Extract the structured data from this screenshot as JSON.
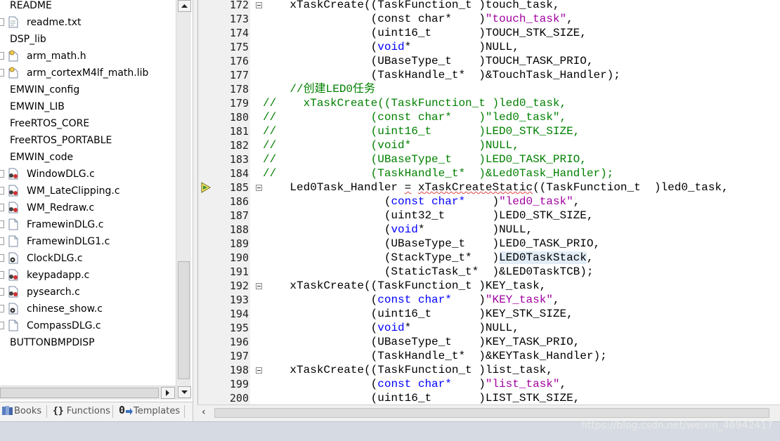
{
  "project_tree": {
    "items": [
      {
        "label": "README",
        "level": 0,
        "icon": "folder-icon"
      },
      {
        "label": "readme.txt",
        "level": 1,
        "icon": "text-file-icon"
      },
      {
        "label": "DSP_lib",
        "level": 0,
        "icon": "folder-icon"
      },
      {
        "label": "arm_math.h",
        "level": 1,
        "icon": "header-file-icon"
      },
      {
        "label": "arm_cortexM4lf_math.lib",
        "level": 1,
        "icon": "library-file-icon"
      },
      {
        "label": "EMWIN_config",
        "level": 0,
        "icon": "folder-icon"
      },
      {
        "label": "EMWIN_LIB",
        "level": 0,
        "icon": "folder-icon"
      },
      {
        "label": "FreeRTOS_CORE",
        "level": 0,
        "icon": "folder-icon"
      },
      {
        "label": "FreeRTOS_PORTABLE",
        "level": 0,
        "icon": "folder-icon"
      },
      {
        "label": "EMWIN_code",
        "level": 0,
        "icon": "folder-icon"
      },
      {
        "label": "WindowDLG.c",
        "level": 1,
        "icon": "c-file-error-icon"
      },
      {
        "label": "WM_LateClipping.c",
        "level": 1,
        "icon": "c-file-error-icon"
      },
      {
        "label": "WM_Redraw.c",
        "level": 1,
        "icon": "c-file-error-icon"
      },
      {
        "label": "FramewinDLG.c",
        "level": 1,
        "icon": "c-file-icon"
      },
      {
        "label": "FramewinDLG1.c",
        "level": 1,
        "icon": "c-file-icon"
      },
      {
        "label": "ClockDLG.c",
        "level": 1,
        "icon": "c-file-gear-icon"
      },
      {
        "label": "keypadapp.c",
        "level": 1,
        "icon": "c-file-error-icon"
      },
      {
        "label": "pysearch.c",
        "level": 1,
        "icon": "c-file-error-icon"
      },
      {
        "label": "chinese_show.c",
        "level": 1,
        "icon": "c-file-gear-icon"
      },
      {
        "label": "CompassDLG.c",
        "level": 1,
        "icon": "c-file-icon"
      },
      {
        "label": "BUTTONBMPDISP",
        "level": 0,
        "icon": "folder-icon"
      }
    ]
  },
  "tabs": [
    {
      "label": "Books",
      "icon": "books-icon"
    },
    {
      "label": "Functions",
      "icon": "braces-icon"
    },
    {
      "label": "Templates",
      "icon": "templates-icon"
    }
  ],
  "editor": {
    "current_line": 185,
    "lines": [
      {
        "n": "172",
        "fold": "open",
        "parts": [
          [
            "",
            "    xTaskCreate((TaskFunction_t )touch_task,"
          ]
        ]
      },
      {
        "n": "173",
        "parts": [
          [
            "",
            "                (const char*    )"
          ],
          [
            "str",
            "\"touch_task\""
          ],
          [
            "",
            ","
          ]
        ]
      },
      {
        "n": "174",
        "parts": [
          [
            "",
            "                (uint16_t       )TOUCH_STK_SIZE,"
          ]
        ]
      },
      {
        "n": "175",
        "parts": [
          [
            "",
            "                ("
          ],
          [
            "kw",
            "void"
          ],
          [
            "",
            "*          )NULL,"
          ]
        ]
      },
      {
        "n": "176",
        "parts": [
          [
            "",
            "                (UBaseType_t    )TOUCH_TASK_PRIO,"
          ]
        ]
      },
      {
        "n": "177",
        "parts": [
          [
            "",
            "                (TaskHandle_t*  )&TouchTask_Handler);"
          ]
        ]
      },
      {
        "n": "178",
        "parts": [
          [
            "cmt",
            "    //创建LED0任务"
          ]
        ]
      },
      {
        "n": "179",
        "parts": [
          [
            "cmt",
            "//    xTaskCreate((TaskFunction_t )led0_task,"
          ]
        ]
      },
      {
        "n": "180",
        "parts": [
          [
            "cmt",
            "//              (const char*    )\"led0_task\","
          ]
        ]
      },
      {
        "n": "181",
        "parts": [
          [
            "cmt",
            "//              (uint16_t       )LED0_STK_SIZE,"
          ]
        ]
      },
      {
        "n": "182",
        "parts": [
          [
            "cmt",
            "//              (void*          )NULL,"
          ]
        ]
      },
      {
        "n": "183",
        "parts": [
          [
            "cmt",
            "//              (UBaseType_t    )LED0_TASK_PRIO,"
          ]
        ]
      },
      {
        "n": "184",
        "parts": [
          [
            "cmt",
            "//              (TaskHandle_t*  )&Led0Task_Handler);"
          ]
        ]
      },
      {
        "n": "185",
        "fold": "open",
        "parts": [
          [
            "",
            "    Led0Task_Handler "
          ],
          [
            "squig",
            "="
          ],
          [
            "",
            " "
          ],
          [
            "squig",
            "xTaskCreateStatic"
          ],
          [
            "",
            "((TaskFunction_t  )led0_task,"
          ]
        ]
      },
      {
        "n": "186",
        "parts": [
          [
            "",
            "                  ("
          ],
          [
            "kw",
            "const char*"
          ],
          [
            "",
            "    )"
          ],
          [
            "str",
            "\"led0_task\""
          ],
          [
            "",
            ","
          ]
        ]
      },
      {
        "n": "187",
        "parts": [
          [
            "",
            "                  (uint32_t       )LED0_STK_SIZE,"
          ]
        ]
      },
      {
        "n": "188",
        "parts": [
          [
            "",
            "                  ("
          ],
          [
            "kw",
            "void"
          ],
          [
            "",
            "*          )NULL,"
          ]
        ]
      },
      {
        "n": "189",
        "parts": [
          [
            "",
            "                  (UBaseType_t    )LED0_TASK_PRIO,"
          ]
        ]
      },
      {
        "n": "190",
        "parts": [
          [
            "",
            "                  (StackType_t*   )"
          ],
          [
            "sel",
            "LED0TaskStack"
          ],
          [
            "",
            ","
          ]
        ]
      },
      {
        "n": "191",
        "parts": [
          [
            "",
            "                  (StaticTask_t*  )&LED0TaskTCB);"
          ]
        ]
      },
      {
        "n": "192",
        "fold": "open",
        "parts": [
          [
            "",
            "    xTaskCreate((TaskFunction_t )KEY_task,"
          ]
        ]
      },
      {
        "n": "193",
        "parts": [
          [
            "",
            "                ("
          ],
          [
            "kw",
            "const char*"
          ],
          [
            "",
            "    )"
          ],
          [
            "str",
            "\"KEY_task\""
          ],
          [
            "",
            ","
          ]
        ]
      },
      {
        "n": "194",
        "parts": [
          [
            "",
            "                (uint16_t       )KEY_STK_SIZE,"
          ]
        ]
      },
      {
        "n": "195",
        "parts": [
          [
            "",
            "                ("
          ],
          [
            "kw",
            "void"
          ],
          [
            "",
            "*          )NULL,"
          ]
        ]
      },
      {
        "n": "196",
        "parts": [
          [
            "",
            "                (UBaseType_t    )KEY_TASK_PRIO,"
          ]
        ]
      },
      {
        "n": "197",
        "parts": [
          [
            "",
            "                (TaskHandle_t*  )&KEYTask_Handler);"
          ]
        ]
      },
      {
        "n": "198",
        "fold": "open",
        "parts": [
          [
            "",
            "    xTaskCreate((TaskFunction_t )list_task,"
          ]
        ]
      },
      {
        "n": "199",
        "parts": [
          [
            "",
            "                ("
          ],
          [
            "kw",
            "const char*"
          ],
          [
            "",
            "    )"
          ],
          [
            "str",
            "\"list_task\""
          ],
          [
            "",
            ","
          ]
        ]
      },
      {
        "n": "200",
        "parts": [
          [
            "",
            "                (uint16_t       )LIST_STK_SIZE,"
          ]
        ]
      }
    ]
  },
  "watermark": "https://blog.csdn.net/weixin_46942417",
  "colors": {
    "keyword": "#0000ff",
    "string": "#a000a0",
    "comment": "#008000",
    "gutter_bg": "#f0f0f0"
  }
}
